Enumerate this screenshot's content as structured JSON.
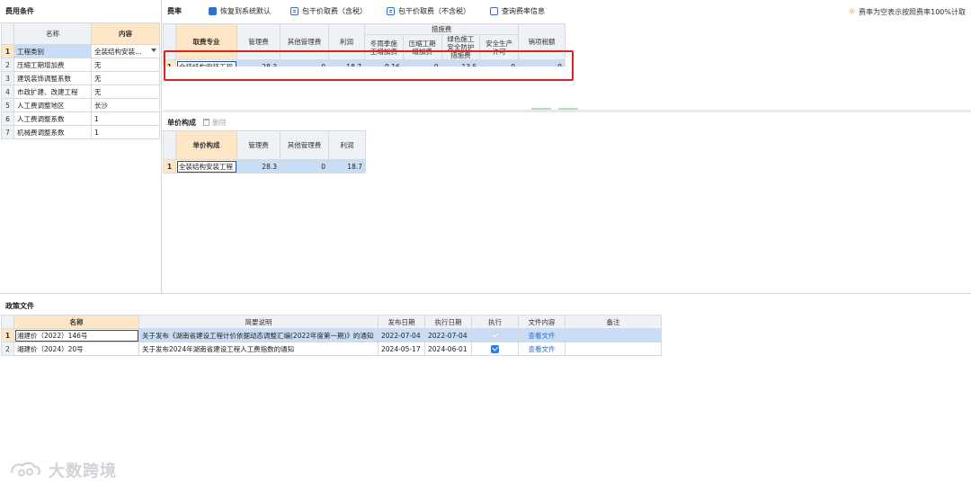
{
  "left": {
    "title": "费用条件",
    "col_name": "名称",
    "col_content": "内容",
    "rows": [
      {
        "n": "1",
        "name": "工程类别",
        "value": "全装结构安装…"
      },
      {
        "n": "2",
        "name": "压缩工期增加费",
        "value": "无"
      },
      {
        "n": "3",
        "name": "建筑装饰调整系数",
        "value": "无"
      },
      {
        "n": "4",
        "name": "市政扩建、改建工程",
        "value": "无"
      },
      {
        "n": "5",
        "name": "人工费调整地区",
        "value": "长沙"
      },
      {
        "n": "6",
        "name": "人工费调整系数",
        "value": "1"
      },
      {
        "n": "7",
        "name": "机械费调整系数",
        "value": "1"
      }
    ]
  },
  "rate": {
    "title": "费率",
    "btn_restore": "恢复到系统默认",
    "btn_incl_tax": "包干价取费（含税）",
    "btn_excl_tax": "包干价取费（不含税）",
    "btn_query": "查询费率信息",
    "note": "费率为空表示按照费率100%计取",
    "headers": {
      "major": "取费专业",
      "mgmt": "管理费",
      "other_mgmt": "其他管理费",
      "profit": "利润",
      "measures": "措施费",
      "winter": "冬雨季施工增加费",
      "compress": "压缩工期增加费",
      "green": "绿色施工安全防护措施费",
      "safety": "安全生产许可",
      "tax": "销项税额"
    },
    "row": {
      "n": "1",
      "major": "全装结构安装工程",
      "mgmt": "28.3",
      "other_mgmt": "0",
      "profit": "18.7",
      "winter": "0.16",
      "compress": "0",
      "green": "13.5",
      "safety": "0",
      "tax": "9"
    }
  },
  "unit": {
    "title": "单价构成",
    "delete": "删除",
    "headers": {
      "major": "单价构成",
      "mgmt": "管理费",
      "other_mgmt": "其他管理费",
      "profit": "利润"
    },
    "row": {
      "n": "1",
      "major": "全装结构安装工程",
      "mgmt": "28.3",
      "other_mgmt": "0",
      "profit": "18.7"
    }
  },
  "policy": {
    "title": "政策文件",
    "headers": {
      "name": "名称",
      "summary": "简要说明",
      "publish": "发布日期",
      "exec_date": "执行日期",
      "exec": "执行",
      "content": "文件内容",
      "remark": "备注"
    },
    "rows": [
      {
        "n": "1",
        "name": "湘建价（2022）146号",
        "summary": "关于发布《湖南省建设工程计价依据动态调整汇编(2022年度第一期)》的通知",
        "publish": "2022-07-04",
        "exec_date": "2022-07-04",
        "content": "查看文件"
      },
      {
        "n": "2",
        "name": "湘建价（2024）20号",
        "summary": "关于发布2024年湖南省建设工程人工费指数的通知",
        "publish": "2024-05-17",
        "exec_date": "2024-06-01",
        "content": "查看文件"
      }
    ]
  },
  "watermark": "大数跨境"
}
